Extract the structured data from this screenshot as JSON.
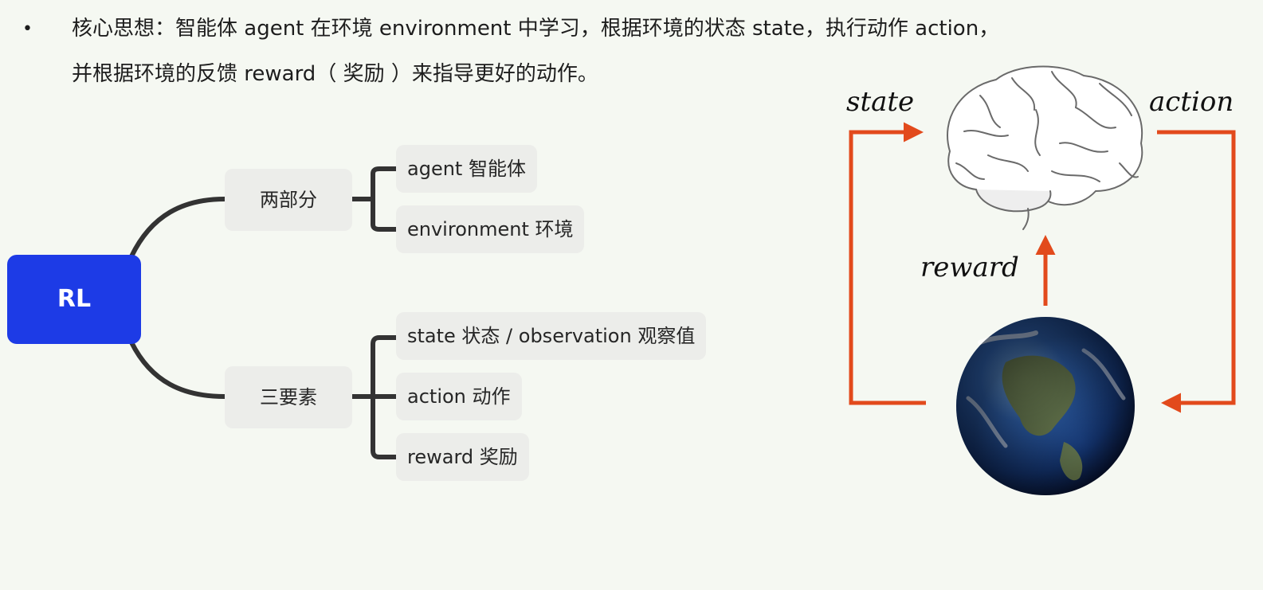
{
  "intro": {
    "bullet": "•",
    "line1": "核心思想：智能体 agent 在环境 environment 中学习，根据环境的状态 state，执行动作 action，",
    "line2": "并根据环境的反馈 reward（ 奖励 ）来指导更好的动作。"
  },
  "mindmap": {
    "root": "RL",
    "branches": [
      {
        "label": "两部分",
        "children": [
          "agent 智能体",
          "environment 环境"
        ]
      },
      {
        "label": "三要素",
        "children": [
          "state 状态 / observation 观察值",
          "action 动作",
          "reward 奖励"
        ]
      }
    ]
  },
  "loop": {
    "state_label": "state",
    "action_label": "action",
    "reward_label": "reward",
    "agent_icon": "brain-icon",
    "environment_icon": "earth-icon",
    "arrow_color": "#e24a1c"
  },
  "colors": {
    "root_fill": "#1d3be6",
    "node_fill": "#ecedea",
    "connector": "#333333",
    "background": "#f5f8f2"
  }
}
